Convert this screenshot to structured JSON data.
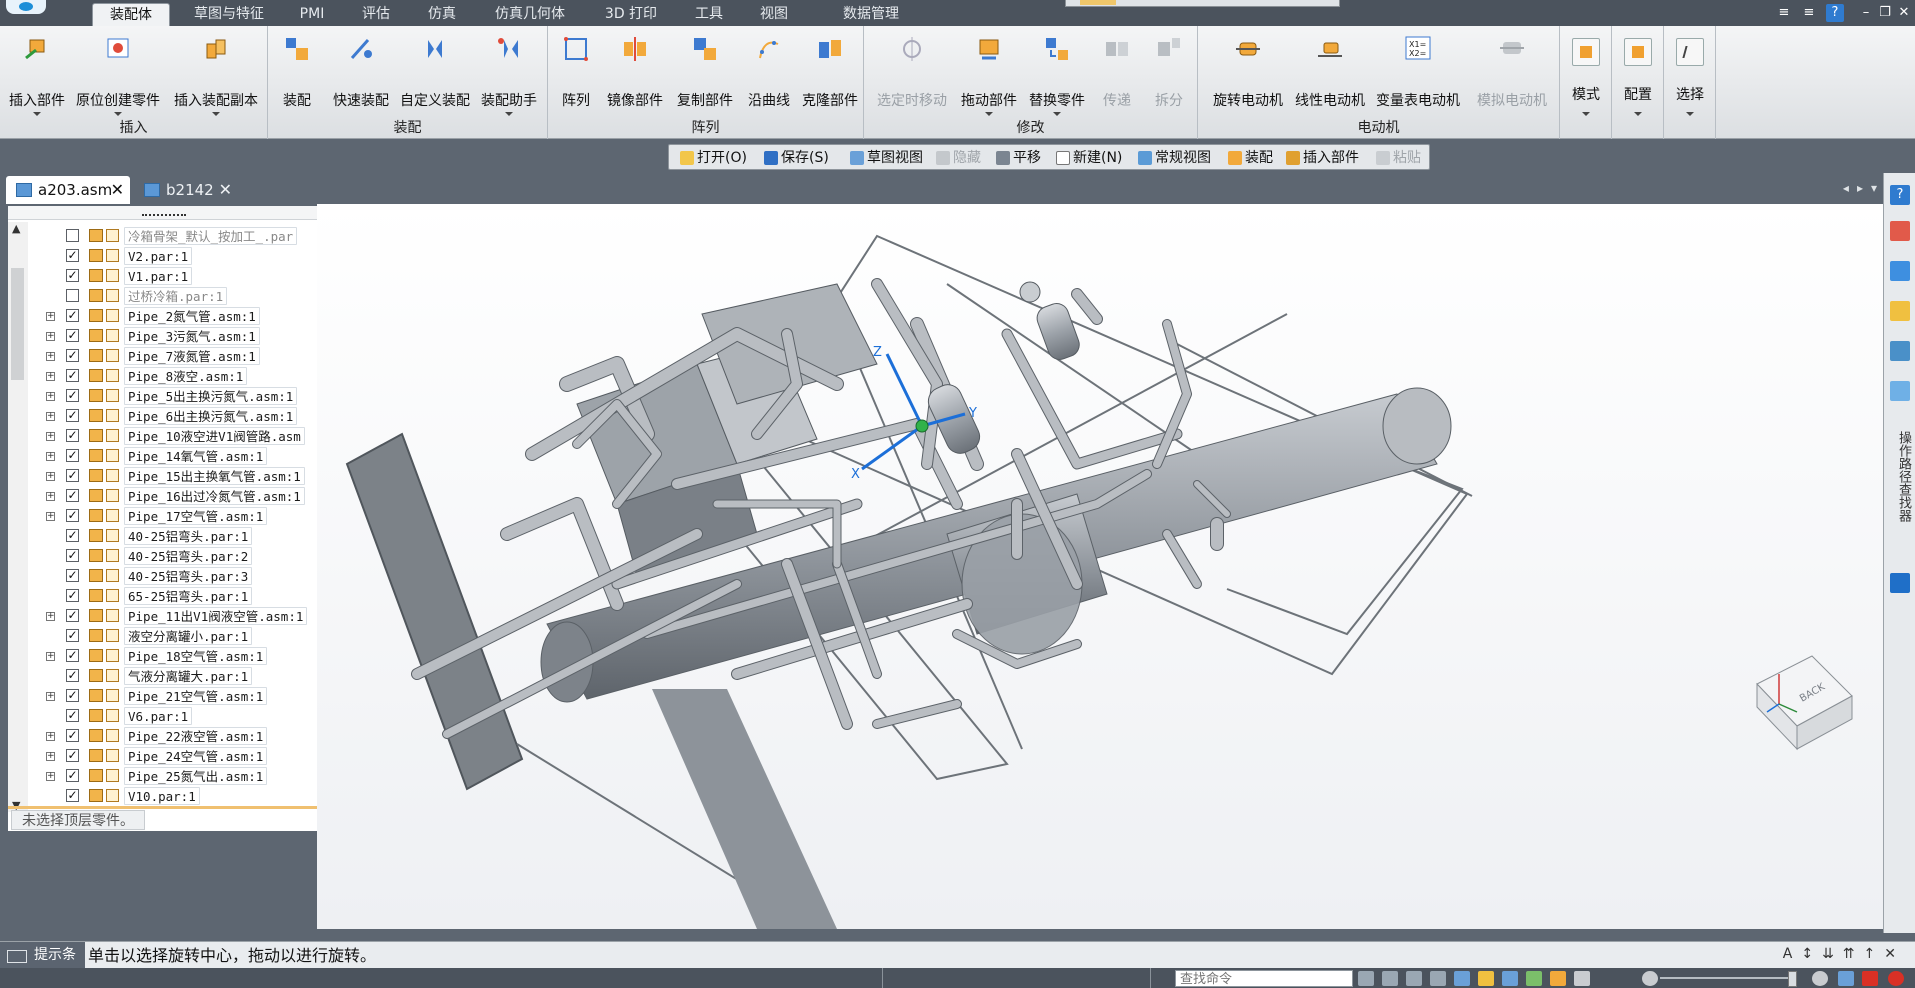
{
  "ribbon_tabs": [
    "装配体",
    "草图与特征",
    "PMI",
    "评估",
    "仿真",
    "仿真几何体",
    "3D 打印",
    "工具",
    "视图",
    "数据管理"
  ],
  "active_tab": "装配体",
  "groups": {
    "insert": {
      "label": "插入",
      "buttons": [
        "插入部件",
        "原位创建零件",
        "插入装配副本"
      ]
    },
    "assemble": {
      "label": "装配",
      "buttons": [
        "装配",
        "快速装配",
        "自定义装配",
        "装配助手"
      ]
    },
    "pattern": {
      "label": "阵列",
      "buttons": [
        "阵列",
        "镜像部件",
        "复制部件",
        "沿曲线",
        "克隆部件"
      ]
    },
    "modify": {
      "label": "修改",
      "buttons": [
        "选定时移动",
        "拖动部件",
        "替换零件",
        "传递",
        "拆分"
      ]
    },
    "motor": {
      "label": "电动机",
      "buttons": [
        "旋转电动机",
        "线性电动机",
        "变量表电动机",
        "模拟电动机"
      ]
    },
    "modes": {
      "buttons": [
        "模式",
        "配置",
        "选择"
      ]
    }
  },
  "quick_toolbar": [
    "打开(O)",
    "保存(S)",
    "草图视图",
    "隐藏",
    "平移",
    "新建(N)",
    "常规视图",
    "装配",
    "插入部件",
    "粘贴"
  ],
  "doc_tabs": [
    "a203.asm",
    "b2142"
  ],
  "tree": [
    {
      "name": "冷箱骨架_默认_按加工_.par",
      "checked": false,
      "expandable": false,
      "dim": true
    },
    {
      "name": "V2.par:1",
      "checked": true,
      "expandable": false
    },
    {
      "name": "V1.par:1",
      "checked": true,
      "expandable": false
    },
    {
      "name": "过桥冷箱.par:1",
      "checked": false,
      "expandable": false,
      "dim": true
    },
    {
      "name": "Pipe_2氮气管.asm:1",
      "checked": true,
      "expandable": true
    },
    {
      "name": "Pipe_3污氮气.asm:1",
      "checked": true,
      "expandable": true
    },
    {
      "name": "Pipe_7液氮管.asm:1",
      "checked": true,
      "expandable": true
    },
    {
      "name": "Pipe_8液空.asm:1",
      "checked": true,
      "expandable": true
    },
    {
      "name": "Pipe_5出主换污氮气.asm:1",
      "checked": true,
      "expandable": true
    },
    {
      "name": "Pipe_6出主换污氮气.asm:1",
      "checked": true,
      "expandable": true
    },
    {
      "name": "Pipe_10液空进V1阀管路.asm",
      "checked": true,
      "expandable": true
    },
    {
      "name": "Pipe_14氧气管.asm:1",
      "checked": true,
      "expandable": true
    },
    {
      "name": "Pipe_15出主换氧气管.asm:1",
      "checked": true,
      "expandable": true
    },
    {
      "name": "Pipe_16出过冷氮气管.asm:1",
      "checked": true,
      "expandable": true
    },
    {
      "name": "Pipe_17空气管.asm:1",
      "checked": true,
      "expandable": true
    },
    {
      "name": "40-25铝弯头.par:1",
      "checked": true,
      "expandable": false
    },
    {
      "name": "40-25铝弯头.par:2",
      "checked": true,
      "expandable": false
    },
    {
      "name": "40-25铝弯头.par:3",
      "checked": true,
      "expandable": false
    },
    {
      "name": "65-25铝弯头.par:1",
      "checked": true,
      "expandable": false
    },
    {
      "name": "Pipe_11出V1阀液空管.asm:1",
      "checked": true,
      "expandable": true
    },
    {
      "name": "液空分离罐小.par:1",
      "checked": true,
      "expandable": false
    },
    {
      "name": "Pipe_18空气管.asm:1",
      "checked": true,
      "expandable": true
    },
    {
      "name": "气液分离罐大.par:1",
      "checked": true,
      "expandable": false
    },
    {
      "name": "Pipe_21空气管.asm:1",
      "checked": true,
      "expandable": true
    },
    {
      "name": "V6.par:1",
      "checked": true,
      "expandable": false
    },
    {
      "name": "Pipe_22液空管.asm:1",
      "checked": true,
      "expandable": true
    },
    {
      "name": "Pipe_24空气管.asm:1",
      "checked": true,
      "expandable": true
    },
    {
      "name": "Pipe_25氮气出.asm:1",
      "checked": true,
      "expandable": true
    },
    {
      "name": "V10.par:1",
      "checked": true,
      "expandable": false
    }
  ],
  "tree_status": "未选择顶层零件。",
  "triad_labels": {
    "x": "X",
    "y": "Y",
    "z": "Z"
  },
  "view_cube_label": "BACK",
  "right_strip_text": "操作路径查找器",
  "prompt": {
    "label": "提示条",
    "text": "单击以选择旋转中心，拖动以进行旋转。"
  },
  "command_search_placeholder": "查找命令",
  "colors": {
    "ribbon_dark": "#4b535d",
    "accent_blue": "#2f7bcf",
    "model_gray": "#8f959c"
  }
}
